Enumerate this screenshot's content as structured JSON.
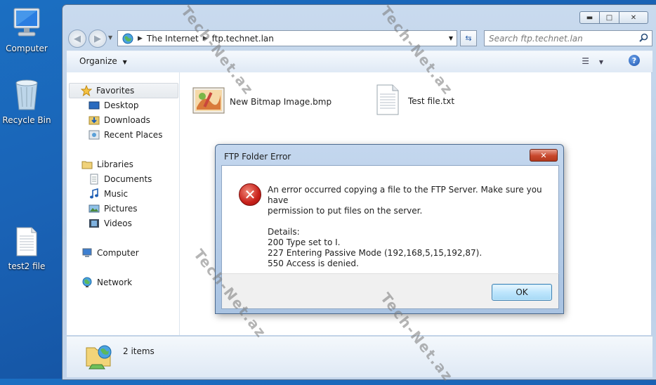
{
  "desktop": {
    "icons": [
      {
        "label": "Computer",
        "icon": "computer-icon"
      },
      {
        "label": "Recycle Bin",
        "icon": "recycle-bin-icon"
      },
      {
        "label": "test2 file",
        "icon": "text-file-icon"
      }
    ]
  },
  "explorer": {
    "address": {
      "crumb1": "The Internet",
      "crumb2": "ftp.technet.lan"
    },
    "search_placeholder": "Search ftp.technet.lan",
    "toolbar": {
      "organize_label": "Organize"
    },
    "nav": {
      "favorites": "Favorites",
      "desktop": "Desktop",
      "downloads": "Downloads",
      "recent_places": "Recent Places",
      "libraries": "Libraries",
      "documents": "Documents",
      "music": "Music",
      "pictures": "Pictures",
      "videos": "Videos",
      "computer": "Computer",
      "network": "Network"
    },
    "files": [
      {
        "name": "New Bitmap Image.bmp",
        "icon": "bitmap-image-icon"
      },
      {
        "name": "Test file.txt",
        "icon": "text-file-icon"
      }
    ],
    "status": {
      "item_count": "2 items"
    }
  },
  "dialog": {
    "title": "FTP Folder Error",
    "message_line1": "An error occurred copying a file to the FTP Server.  Make sure you have",
    "message_line2": "permission to put files on the server.",
    "details_label": "Details:",
    "detail1": "200 Type set to I.",
    "detail2": "227 Entering Passive Mode (192,168,5,15,192,87).",
    "detail3": "550 Access is denied.",
    "ok_label": "OK"
  },
  "watermark": "Tech-Net.az",
  "colors": {
    "desktop_bg": "#1a63b6",
    "error_red": "#c8201a",
    "ok_button": "#bee6fd"
  }
}
